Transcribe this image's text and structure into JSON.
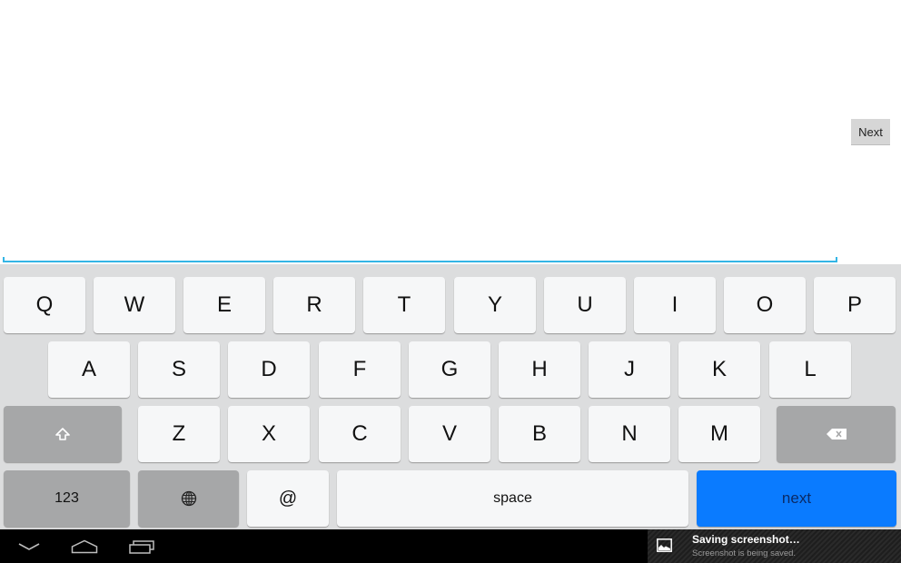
{
  "app": {
    "next_button_label": "Next"
  },
  "keyboard": {
    "row1": [
      "Q",
      "W",
      "E",
      "R",
      "T",
      "Y",
      "U",
      "I",
      "O",
      "P"
    ],
    "row2": [
      "A",
      "S",
      "D",
      "F",
      "G",
      "H",
      "J",
      "K",
      "L"
    ],
    "row3": [
      "Z",
      "X",
      "C",
      "V",
      "B",
      "N",
      "M"
    ],
    "numbers_label": "123",
    "at_label": "@",
    "space_label": "space",
    "action_label": "next",
    "icons": {
      "shift": "shift-icon",
      "backspace": "backspace-icon",
      "language": "globe-icon"
    }
  },
  "navbar": {
    "back": "back-icon",
    "home": "home-icon",
    "recents": "recents-icon"
  },
  "notification": {
    "title": "Saving screenshot…",
    "subtitle": "Screenshot is being saved.",
    "icon": "image-icon"
  },
  "colors": {
    "accent": "#33b5e5",
    "action_key": "#0a7bff",
    "function_key": "#a6a7a8",
    "key": "#f6f7f8",
    "keyboard_bg": "#dcddde"
  }
}
